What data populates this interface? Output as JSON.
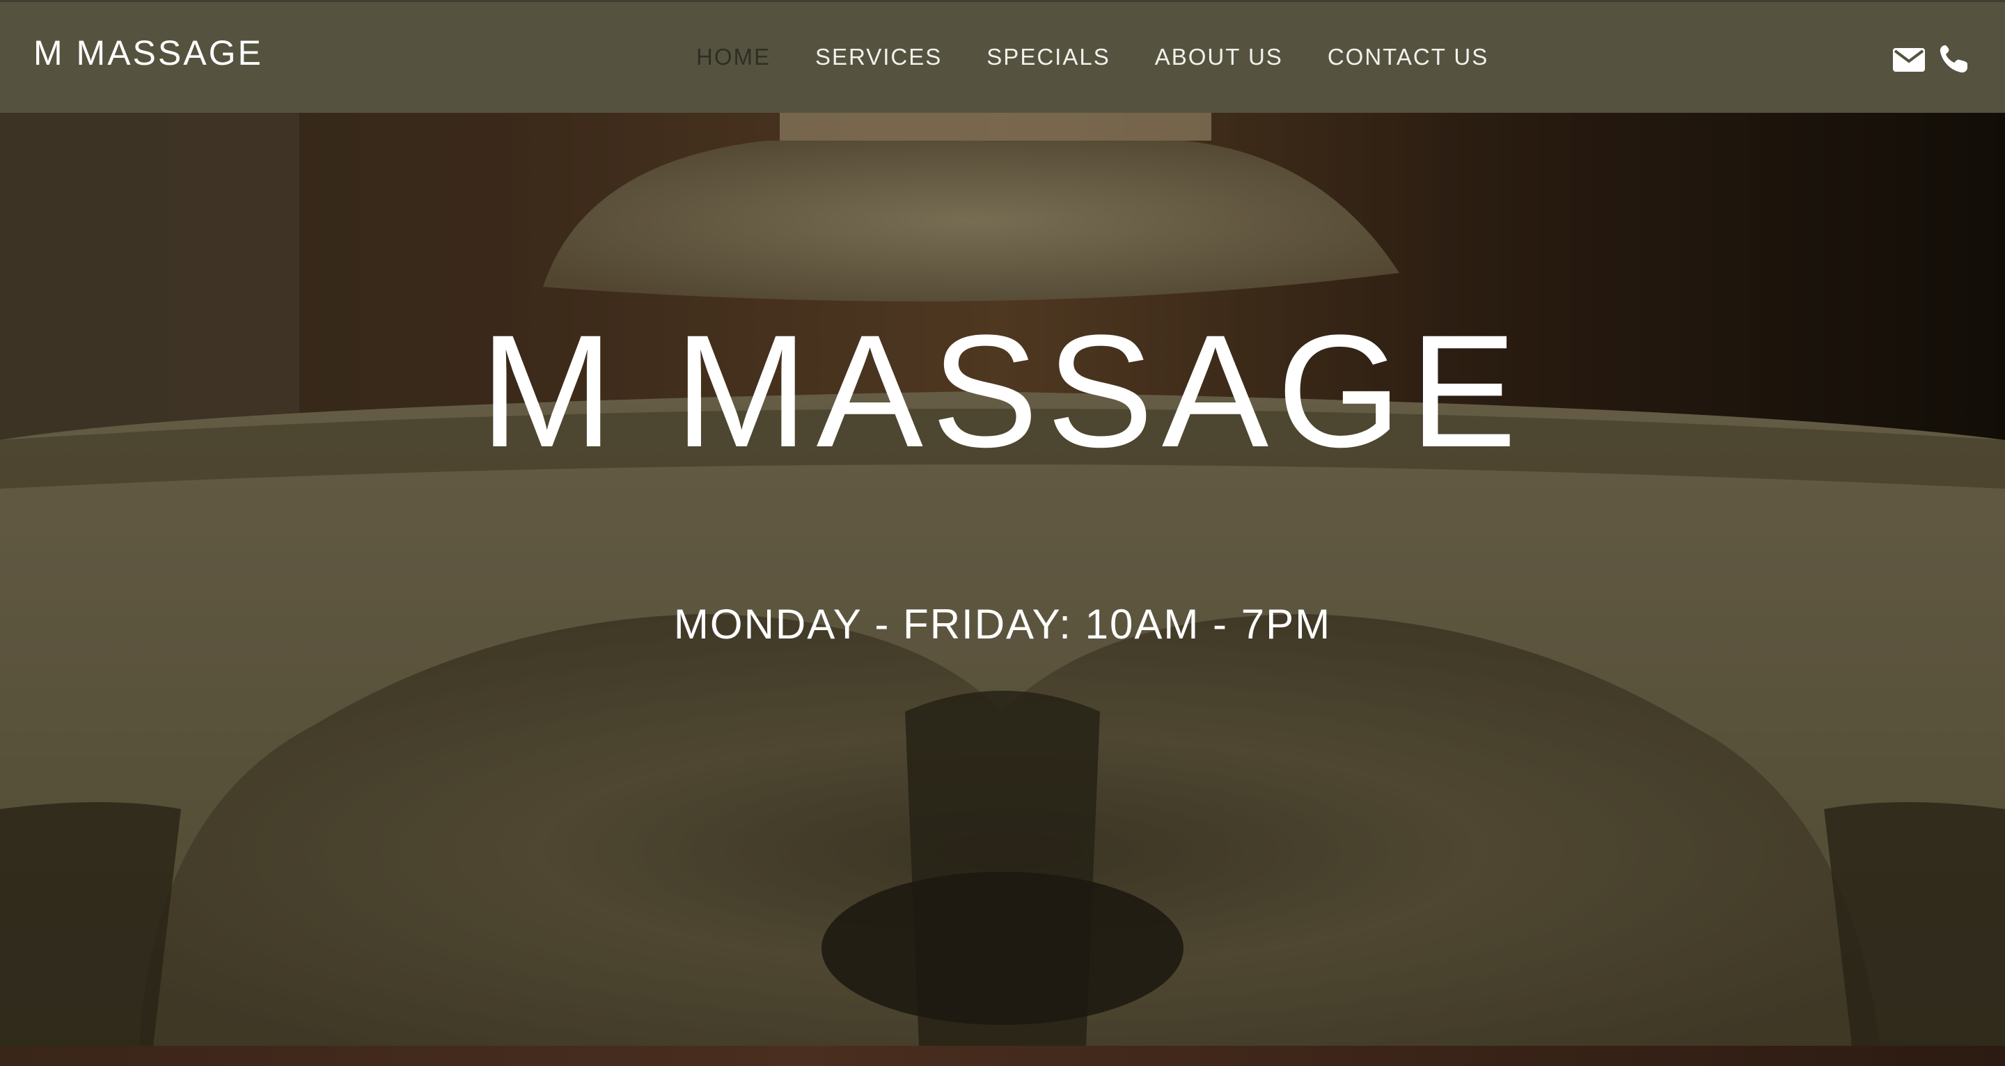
{
  "header": {
    "logo": "M MASSAGE",
    "nav": [
      {
        "label": "HOME",
        "active": true
      },
      {
        "label": "SERVICES",
        "active": false
      },
      {
        "label": "SPECIALS",
        "active": false
      },
      {
        "label": "ABOUT US",
        "active": false
      },
      {
        "label": "CONTACT US",
        "active": false
      }
    ],
    "icons": [
      "envelope-icon",
      "phone-icon"
    ]
  },
  "hero": {
    "title": "M MASSAGE",
    "hours": "MONDAY - FRIDAY: 10AM - 7PM"
  },
  "colors": {
    "header_bg": "#55533f",
    "active_nav": "#2f2e25",
    "nav_text": "#f2f2ec"
  }
}
